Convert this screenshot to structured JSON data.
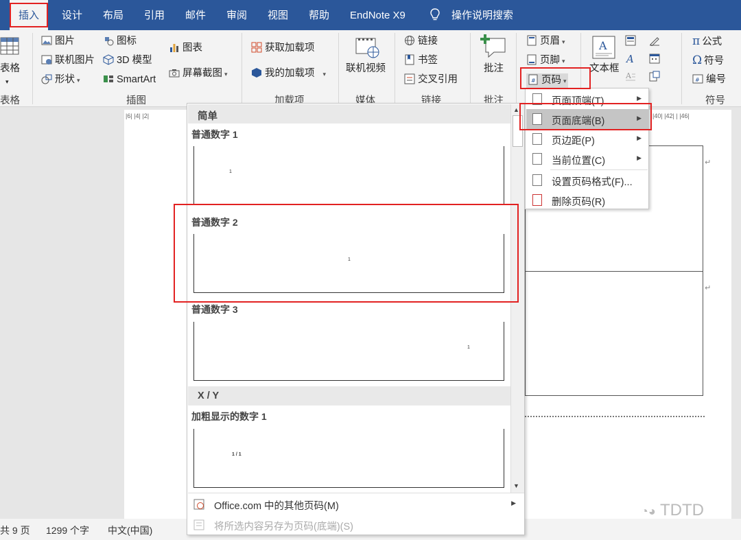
{
  "tabs": [
    {
      "label": "插入",
      "active": true
    },
    {
      "label": "设计"
    },
    {
      "label": "布局"
    },
    {
      "label": "引用"
    },
    {
      "label": "邮件"
    },
    {
      "label": "审阅"
    },
    {
      "label": "视图"
    },
    {
      "label": "帮助"
    },
    {
      "label": "EndNote X9"
    },
    {
      "label": "操作说明搜索"
    }
  ],
  "ribbon": {
    "table": {
      "button": "表格",
      "group": "表格"
    },
    "illustrations": {
      "picture": "图片",
      "icons": "图标",
      "chart": "图表",
      "online_picture": "联机图片",
      "model3d": "3D 模型",
      "shapes": "形状",
      "smartart": "SmartArt",
      "screenshot": "屏幕截图",
      "group": "插图"
    },
    "addins": {
      "get": "获取加载项",
      "my": "我的加载项",
      "group": "加载项"
    },
    "media": {
      "video": "联机视频",
      "group": "媒体"
    },
    "links": {
      "link": "链接",
      "bookmark": "书签",
      "crossref": "交叉引用",
      "group": "链接"
    },
    "comments": {
      "comment": "批注",
      "group": "批注"
    },
    "header_footer": {
      "header": "页眉",
      "footer": "页脚",
      "page_number": "页码"
    },
    "text": {
      "textbox": "文本框"
    },
    "symbols": {
      "equation": "公式",
      "symbol": "符号",
      "numbering": "编号",
      "group": "符号"
    }
  },
  "submenu": {
    "items": [
      {
        "label": "页面顶端(T)",
        "arrow": true
      },
      {
        "label": "页面底端(B)",
        "arrow": true,
        "highlighted": true
      },
      {
        "label": "页边距(P)",
        "arrow": true
      },
      {
        "label": "当前位置(C)",
        "arrow": true
      },
      {
        "label": "设置页码格式(F)..."
      },
      {
        "label": "删除页码(R)"
      }
    ]
  },
  "gallery": {
    "section_simple": "简单",
    "items": [
      {
        "title": "普通数字 1",
        "sample": "1",
        "align": "left"
      },
      {
        "title": "普通数字 2",
        "sample": "1",
        "align": "center"
      },
      {
        "title": "普通数字 3",
        "sample": "1",
        "align": "right"
      }
    ],
    "section_xy": "X / Y",
    "bold_item": {
      "title": "加粗显示的数字 1",
      "sample": "1 / 1"
    },
    "footer_more": "Office.com 中的其他页码(M)",
    "footer_save": "将所选内容另存为页码(底端)(S)"
  },
  "ruler": {
    "left_marks": "|6|  |4|  |2|",
    "right_marks": "|40|  |42|  |  |46|"
  },
  "status": {
    "pages": "共 9 页",
    "words": "1299 个字",
    "language": "中文(中国)"
  },
  "watermark": "TDTD",
  "colors": {
    "ribbon_blue": "#2b579a",
    "highlight_red": "#e22121"
  }
}
